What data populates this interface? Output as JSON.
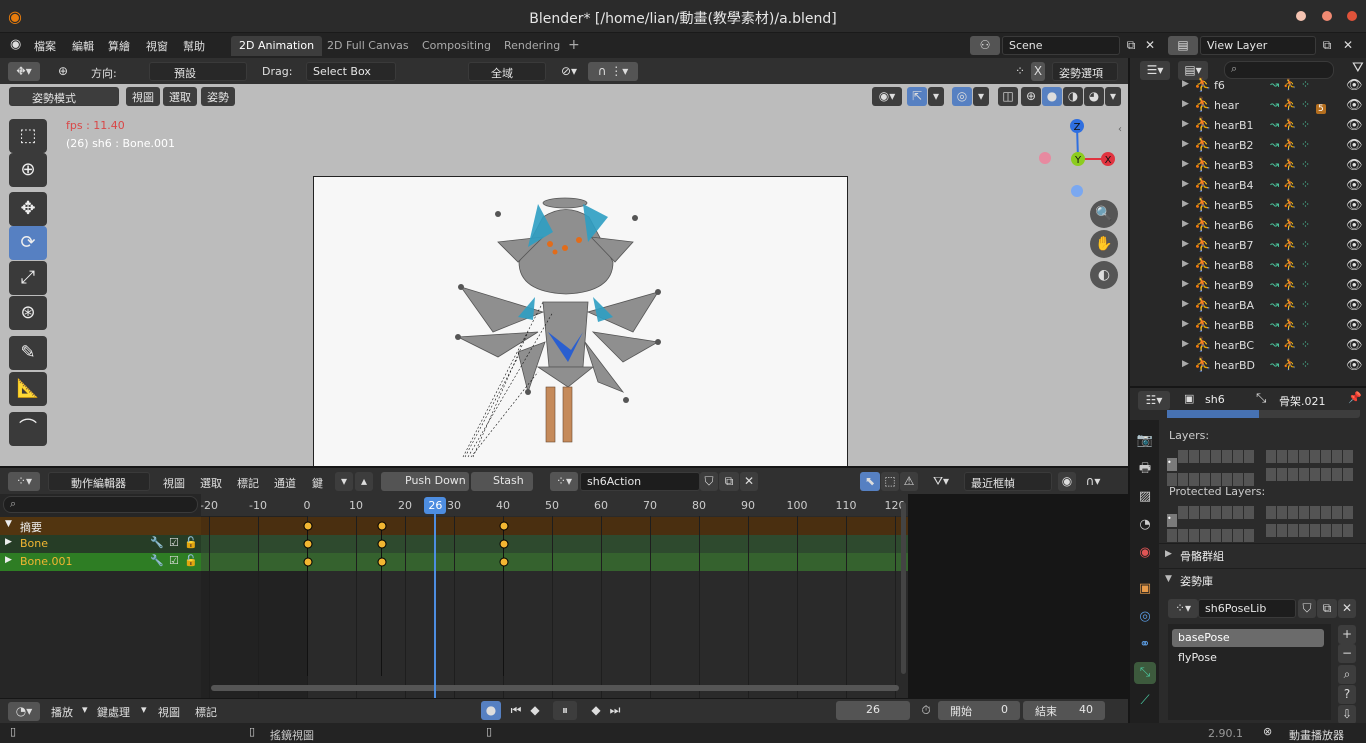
{
  "window": {
    "title": "Blender* [/home/lian/動畫(教學素材)/a.blend]"
  },
  "menu": [
    "檔案",
    "編輯",
    "算繪",
    "視窗",
    "幫助"
  ],
  "workspaces": [
    "2D Animation",
    "2D Full Canvas",
    "Compositing",
    "Rendering",
    "+"
  ],
  "scene": "Scene",
  "view_layer": "View Layer",
  "header3d": {
    "orientation_label": "方向:",
    "orientation": "預設",
    "drag_label": "Drag:",
    "drag": "Select Box",
    "transform": "全域",
    "pose_options": "姿勢選項"
  },
  "subheader": {
    "mode": "姿勢模式",
    "view": "視圖",
    "select": "選取",
    "pose": "姿勢"
  },
  "viewport": {
    "fps": "fps : 11.40",
    "info": "(26) sh6 : Bone.001"
  },
  "gizmo": {
    "z": "Z",
    "y": "Y",
    "x": "X"
  },
  "dope": {
    "editor": "動作編輯器",
    "view": "視圖",
    "select": "選取",
    "marker": "標記",
    "channel": "通道",
    "key": "鍵",
    "push_down": "Push Down",
    "stash": "Stash",
    "action": "sh6Action",
    "sync": "最近框幀"
  },
  "ruler": [
    -20,
    -10,
    0,
    10,
    20,
    30,
    40,
    50,
    60,
    70,
    80,
    90,
    100,
    110,
    120
  ],
  "current_frame": "26",
  "channels": [
    {
      "name": "摘要",
      "color": "#ffffff"
    },
    {
      "name": "Bone",
      "color": "#f2b632"
    },
    {
      "name": "Bone.001",
      "color": "#f2b632"
    }
  ],
  "keyframes": [
    0,
    15,
    40
  ],
  "timeline": {
    "playback": "播放",
    "keying": "鍵處理",
    "view": "視圖",
    "marker": "標記",
    "frame": "26",
    "start_label": "開始",
    "start": "0",
    "end_label": "結束",
    "end": "40"
  },
  "status": {
    "left": "搖鏡視圖",
    "version": "2.90.1",
    "right": "動畫播放器"
  },
  "outliner": {
    "items": [
      "f6",
      "hear",
      "hearB1",
      "hearB2",
      "hearB3",
      "hearB4",
      "hearB5",
      "hearB6",
      "hearB7",
      "hearB8",
      "hearB9",
      "hearBA",
      "hearBB",
      "hearBC",
      "hearBD"
    ],
    "badge": "5"
  },
  "props": {
    "object": "sh6",
    "armature": "骨架.021",
    "layers": "Layers:",
    "protected": "Protected Layers:",
    "bone_groups": "骨骼群組",
    "pose_lib": "姿勢庫",
    "pose_lib_name": "sh6PoseLib",
    "poses": [
      "basePose",
      "flyPose"
    ]
  }
}
